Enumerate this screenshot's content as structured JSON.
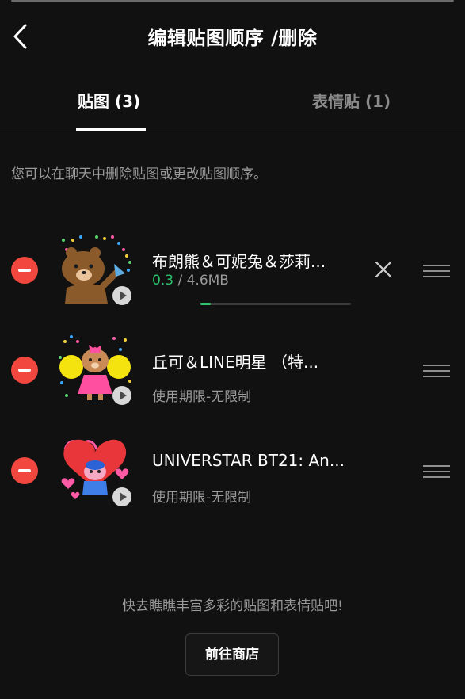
{
  "header": {
    "title": "编辑贴图顺序 /删除",
    "back_icon": "chevron-left-icon"
  },
  "tabs": [
    {
      "label": "贴图 (3)",
      "active": true
    },
    {
      "label": "表情贴 (1)",
      "active": false
    }
  ],
  "hint": "您可以在聊天中删除贴图或更改贴图顺序。",
  "stickers": [
    {
      "title": "布朗熊＆可妮兔＆莎莉...",
      "downloading": true,
      "download_current": "0.3",
      "download_sep": " / ",
      "download_total": "4.6MB",
      "progress": 0.07,
      "thumb_icon": "brown-bear-sticker-icon"
    },
    {
      "title": "丘可＆LINE明星 （特...",
      "subtitle": "使用期限-无限制",
      "thumb_icon": "choco-cheer-sticker-icon"
    },
    {
      "title": "UNIVERSTAR BT21: An...",
      "subtitle": "使用期限-无限制",
      "thumb_icon": "tata-heart-sticker-icon"
    }
  ],
  "footer": {
    "hint": "快去瞧瞧丰富多彩的贴图和表情贴吧!",
    "shop_button": "前往商店"
  },
  "colors": {
    "background": "#111111",
    "remove_red": "#f2473f",
    "progress_green": "#2ec56e",
    "muted_text": "#9a9a9a"
  }
}
